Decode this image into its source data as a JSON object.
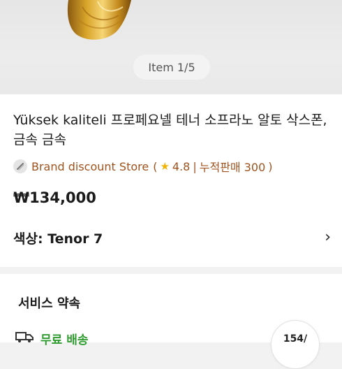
{
  "gallery": {
    "counter": "Item 1/5"
  },
  "product": {
    "title": "Yüksek kaliteli 프로페요넬 테너 소프라노 알토 삭스폰, 금속 금속",
    "store": {
      "icon": "saxophone-icon",
      "name": "Brand discount Store",
      "open_paren": "(",
      "rating": "4.8",
      "separator": "|",
      "sales": "누적판매 300",
      "close_paren": ")"
    },
    "price": "₩134,000",
    "option": {
      "label": "색상: Tenor 7"
    }
  },
  "service": {
    "title": "서비스 약속",
    "shipping": "무료 배송",
    "badge": "154/"
  },
  "colors": {
    "store_text": "#a0521d",
    "star": "#f0b400",
    "shipping_green": "#2f9d2f"
  }
}
